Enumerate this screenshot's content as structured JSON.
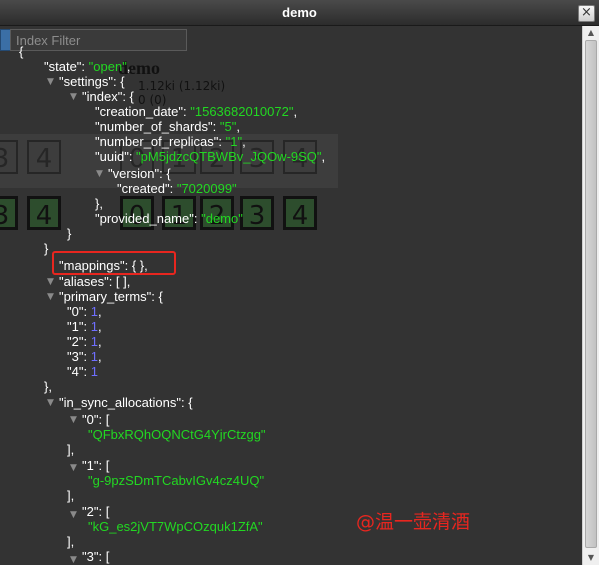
{
  "window": {
    "title": "demo",
    "close_glyph": "×"
  },
  "background": {
    "filter_placeholder": "Index Filter",
    "index_name": "demo",
    "size": "1.12ki (1.12ki)",
    "docs": "0 (0)",
    "shards_row1": [
      "3",
      "4",
      "0",
      "1",
      "2",
      "3",
      "4"
    ],
    "shards_row2": [
      "3",
      "4",
      "0",
      "1",
      "2",
      "3",
      "4"
    ]
  },
  "json": {
    "open_brace": "{",
    "state_key": "\"state\"",
    "state_value": "\"open\"",
    "settings_key": "\"settings\"",
    "index_key": "\"index\"",
    "creation_date_key": "\"creation_date\"",
    "creation_date_value": "\"1563682010072\"",
    "number_of_shards_key": "\"number_of_shards\"",
    "number_of_shards_value": "\"5\"",
    "number_of_replicas_key": "\"number_of_replicas\"",
    "number_of_replicas_value": "\"1\"",
    "uuid_key": "\"uuid\"",
    "uuid_value": "\"pM5jdzcQTBWBv_JQOw-9SQ\"",
    "version_key": "\"version\"",
    "created_key": "\"created\"",
    "created_value": "\"7020099\"",
    "provided_name_key": "\"provided_name\"",
    "provided_name_value": "\"demo\"",
    "mappings_line": "\"mappings\": { },",
    "aliases_line": "\"aliases\": [ ],",
    "primary_terms_key": "\"primary_terms\"",
    "primary_terms": [
      {
        "key": "\"0\"",
        "value": "1"
      },
      {
        "key": "\"1\"",
        "value": "1"
      },
      {
        "key": "\"2\"",
        "value": "1"
      },
      {
        "key": "\"3\"",
        "value": "1"
      },
      {
        "key": "\"4\"",
        "value": "1"
      }
    ],
    "in_sync_key": "\"in_sync_allocations\"",
    "in_sync": [
      {
        "key": "\"0\"",
        "value": "\"QFbxRQhOQNCtG4YjrCtzgg\""
      },
      {
        "key": "\"1\"",
        "value": "\"g-9pzSDmTCabvIGv4cz4UQ\""
      },
      {
        "key": "\"2\"",
        "value": "\"kG_es2jVT7WpCOzquk1ZfA\""
      },
      {
        "key": "\"3\"",
        "value": ""
      }
    ]
  },
  "watermark": "@温一壶清酒"
}
